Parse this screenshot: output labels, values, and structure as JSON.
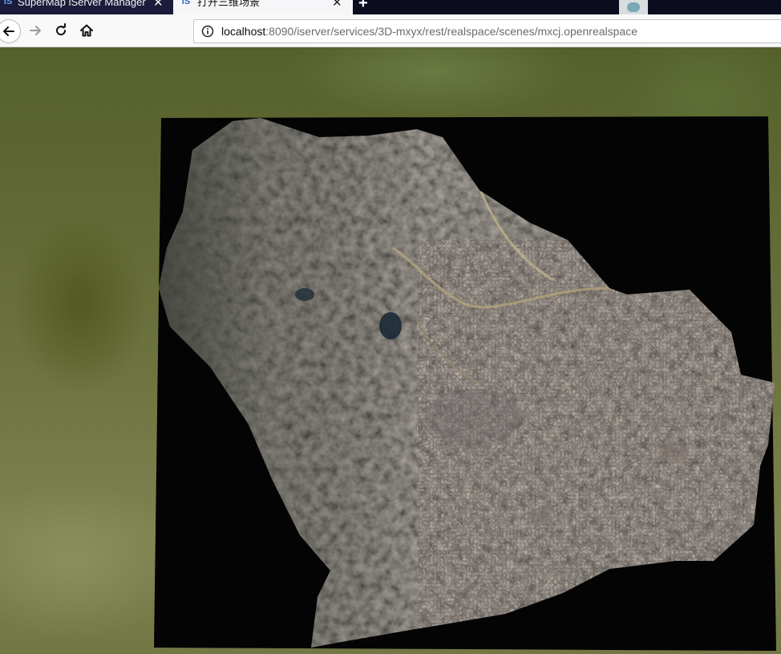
{
  "tabs": [
    {
      "title": "SuperMap iServer Manager",
      "favicon": "supermap-favicon",
      "active": false
    },
    {
      "title": "打开三维场景",
      "favicon": "supermap-favicon",
      "active": true
    }
  ],
  "tab_favicon_text": "iS",
  "close_glyph": "✕",
  "new_tab_glyph": "+",
  "nav": {
    "back_icon": "back-arrow-icon",
    "forward_icon": "forward-arrow-icon",
    "reload_icon": "reload-icon",
    "home_icon": "home-icon"
  },
  "address_bar": {
    "host": "localhost",
    "rest": ":8090/iserver/services/3D-mxyx/rest/realspace/scenes/mxcj.openrealspace",
    "info_icon": "info-icon"
  },
  "colors": {
    "tab_strip": "#0c0c20",
    "active_tab": "#f6f6f8",
    "toolbar": "#f9f9fa",
    "terrain_frame": "#040404",
    "imagery": "#3a3c34"
  },
  "scene": {
    "description_type": "3D realspace scene with satellite imagery tile",
    "imagery_layer": "satellite-imagery"
  }
}
